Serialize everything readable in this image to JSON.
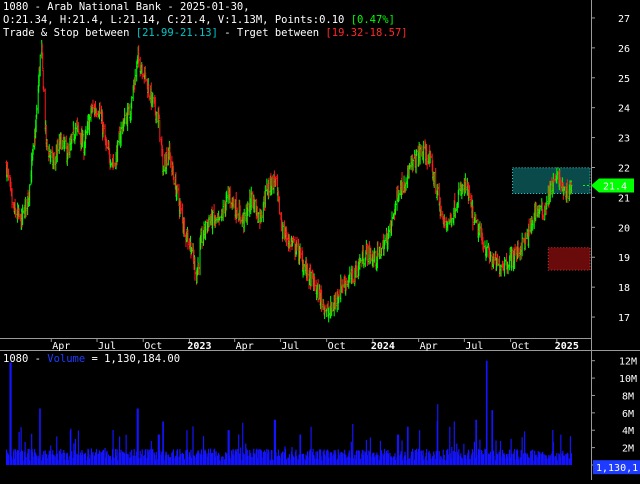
{
  "header": {
    "line1": "1080 - Arab National Bank - 2025-01-30,",
    "line2_prefix": "O:21.34, H:21.4, L:21.14, C:21.4, V:1.13M, Points:0.10 ",
    "line2_change": "[0.47%]",
    "line3_prefix": "Trade & Stop between ",
    "line3_trade": "[21.99-21.13]",
    "line3_mid": " - Trget between ",
    "line3_target": "[19.32-18.57]"
  },
  "volume_header": {
    "prefix": "1080 - ",
    "series": "Volume",
    "suffix": " = 1,130,184.00"
  },
  "last_price_label": "21.4",
  "last_volume_label": "1,130,1",
  "colors": {
    "background": "#000000",
    "up": "#00ff00",
    "down": "#ff1a1a",
    "volume": "#1414ff",
    "trade_zone": "#0b4a4a",
    "target_zone": "#6a0b0b",
    "grid": "#505050"
  },
  "chart_data": [
    {
      "type": "candlestick",
      "title": "1080 - Arab National Bank",
      "x_tick_labels": [
        "Apr",
        "Jul",
        "Oct",
        "2023",
        "Apr",
        "Jul",
        "Oct",
        "2024",
        "Apr",
        "Jul",
        "Oct",
        "2025"
      ],
      "y_tick_labels": [
        "17",
        "18",
        "19",
        "20",
        "21",
        "22",
        "23",
        "24",
        "25",
        "26",
        "27"
      ],
      "ylim": [
        16.3,
        27.6
      ],
      "grid": true,
      "price_path": [
        [
          "2022-01-01",
          22.1
        ],
        [
          "2022-01-15",
          20.6
        ],
        [
          "2022-02-01",
          20.2
        ],
        [
          "2022-02-15",
          21.1
        ],
        [
          "2022-03-01",
          23.3
        ],
        [
          "2022-03-12",
          26.2
        ],
        [
          "2022-03-22",
          22.8
        ],
        [
          "2022-04-05",
          22.1
        ],
        [
          "2022-04-20",
          22.9
        ],
        [
          "2022-05-05",
          22.4
        ],
        [
          "2022-05-20",
          23.4
        ],
        [
          "2022-06-05",
          22.7
        ],
        [
          "2022-06-20",
          23.9
        ],
        [
          "2022-07-05",
          24.0
        ],
        [
          "2022-07-20",
          22.6
        ],
        [
          "2022-08-05",
          22.1
        ],
        [
          "2022-08-20",
          23.4
        ],
        [
          "2022-09-05",
          23.9
        ],
        [
          "2022-09-20",
          25.6
        ],
        [
          "2022-10-01",
          25.3
        ],
        [
          "2022-10-15",
          24.4
        ],
        [
          "2022-11-01",
          23.6
        ],
        [
          "2022-11-10",
          21.9
        ],
        [
          "2022-11-20",
          22.6
        ],
        [
          "2022-12-05",
          21.3
        ],
        [
          "2022-12-20",
          20.1
        ],
        [
          "2023-01-05",
          19.3
        ],
        [
          "2023-01-15",
          18.4
        ],
        [
          "2023-01-25",
          19.6
        ],
        [
          "2023-02-10",
          20.3
        ],
        [
          "2023-03-01",
          20.1
        ],
        [
          "2023-03-20",
          21.1
        ],
        [
          "2023-04-05",
          20.6
        ],
        [
          "2023-04-20",
          20.2
        ],
        [
          "2023-05-05",
          21.0
        ],
        [
          "2023-05-20",
          20.3
        ],
        [
          "2023-06-05",
          21.3
        ],
        [
          "2023-06-20",
          21.6
        ],
        [
          "2023-07-05",
          19.9
        ],
        [
          "2023-07-20",
          19.5
        ],
        [
          "2023-08-05",
          19.2
        ],
        [
          "2023-08-20",
          18.6
        ],
        [
          "2023-09-05",
          18.1
        ],
        [
          "2023-09-20",
          17.6
        ],
        [
          "2023-10-05",
          17.1
        ],
        [
          "2023-10-15",
          17.4
        ],
        [
          "2023-11-01",
          18.1
        ],
        [
          "2023-11-20",
          18.3
        ],
        [
          "2023-12-05",
          18.8
        ],
        [
          "2023-12-20",
          19.2
        ],
        [
          "2024-01-05",
          18.9
        ],
        [
          "2024-01-20",
          19.3
        ],
        [
          "2024-02-05",
          19.9
        ],
        [
          "2024-02-20",
          21.2
        ],
        [
          "2024-03-05",
          21.6
        ],
        [
          "2024-03-20",
          22.1
        ],
        [
          "2024-04-05",
          22.5
        ],
        [
          "2024-04-20",
          22.4
        ],
        [
          "2024-05-05",
          21.4
        ],
        [
          "2024-05-20",
          20.1
        ],
        [
          "2024-06-05",
          20.3
        ],
        [
          "2024-06-20",
          21.1
        ],
        [
          "2024-07-05",
          21.4
        ],
        [
          "2024-07-20",
          20.2
        ],
        [
          "2024-08-05",
          19.6
        ],
        [
          "2024-08-20",
          19.0
        ],
        [
          "2024-09-05",
          18.7
        ],
        [
          "2024-09-20",
          18.8
        ],
        [
          "2024-10-05",
          19.0
        ],
        [
          "2024-10-20",
          19.3
        ],
        [
          "2024-11-05",
          19.7
        ],
        [
          "2024-11-20",
          20.6
        ],
        [
          "2024-12-05",
          20.5
        ],
        [
          "2024-12-20",
          21.3
        ],
        [
          "2025-01-05",
          21.7
        ],
        [
          "2025-01-15",
          21.1
        ],
        [
          "2025-01-30",
          21.4
        ]
      ],
      "last_bar": {
        "date": "2025-01-30",
        "open": 21.34,
        "high": 21.4,
        "low": 21.14,
        "close": 21.4
      },
      "zones": [
        {
          "name": "Trade & Stop",
          "from_date": "2024-10-05",
          "to_date": "2025-03-10",
          "low": 21.13,
          "high": 21.99
        },
        {
          "name": "Trget",
          "from_date": "2024-12-15",
          "to_date": "2025-03-10",
          "low": 18.57,
          "high": 19.32
        }
      ]
    },
    {
      "type": "bar",
      "title": "Volume",
      "y_tick_labels": [
        "0",
        "2M",
        "4M",
        "6M",
        "8M",
        "10M",
        "12M"
      ],
      "ylim": [
        0,
        13000000
      ],
      "typical_volume": 1500000,
      "spikes": [
        [
          "2022-01-10",
          11800000
        ],
        [
          "2022-01-28",
          3800000
        ],
        [
          "2022-03-10",
          6500000
        ],
        [
          "2022-05-20",
          3000000
        ],
        [
          "2022-09-20",
          6500000
        ],
        [
          "2022-11-01",
          3500000
        ],
        [
          "2022-11-10",
          5000000
        ],
        [
          "2023-03-20",
          4000000
        ],
        [
          "2023-06-20",
          5200000
        ],
        [
          "2023-08-10",
          3500000
        ],
        [
          "2023-09-01",
          4400000
        ],
        [
          "2024-02-20",
          3500000
        ],
        [
          "2024-03-10",
          4400000
        ],
        [
          "2024-05-10",
          7000000
        ],
        [
          "2024-06-01",
          4400000
        ],
        [
          "2024-07-25",
          5200000
        ],
        [
          "2024-08-15",
          12000000
        ],
        [
          "2024-08-25",
          6300000
        ],
        [
          "2024-10-25",
          3200000
        ],
        [
          "2025-01-10",
          3500000
        ]
      ],
      "last_value": 1130184
    }
  ]
}
